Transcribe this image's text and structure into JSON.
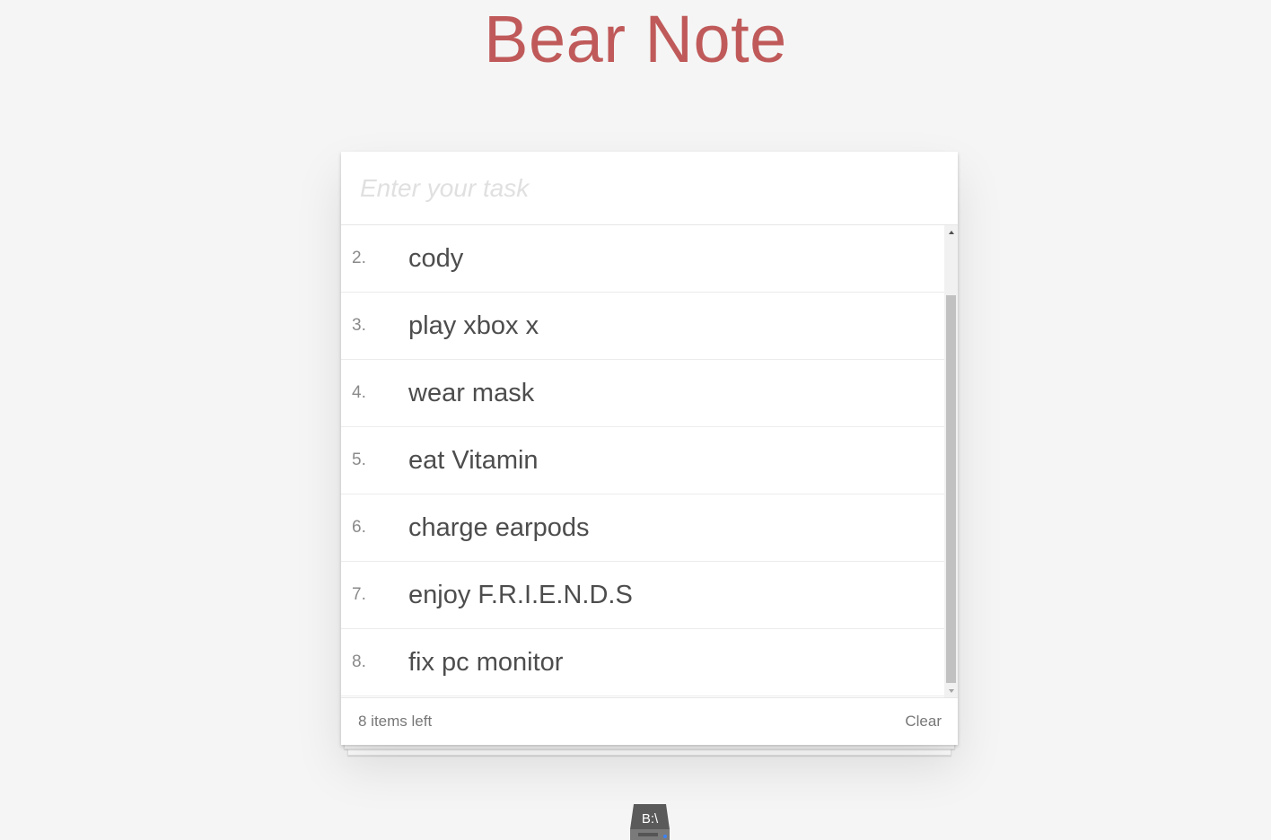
{
  "header": {
    "title": "Bear Note"
  },
  "input": {
    "placeholder": "Enter your task"
  },
  "tasks": [
    {
      "num": "2.",
      "text": "cody"
    },
    {
      "num": "3.",
      "text": "play xbox x"
    },
    {
      "num": "4.",
      "text": "wear mask"
    },
    {
      "num": "5.",
      "text": "eat Vitamin"
    },
    {
      "num": "6.",
      "text": "charge earpods"
    },
    {
      "num": "7.",
      "text": "enjoy F.R.I.E.N.D.S"
    },
    {
      "num": "8.",
      "text": "fix pc monitor"
    }
  ],
  "footer": {
    "items_left": "8 items left",
    "clear_label": "Clear"
  },
  "drive": {
    "label": "B:\\",
    "icon": "drive-icon"
  },
  "colors": {
    "title": "#c05a5a",
    "background": "#f5f5f5",
    "text": "#4d4d4d"
  }
}
